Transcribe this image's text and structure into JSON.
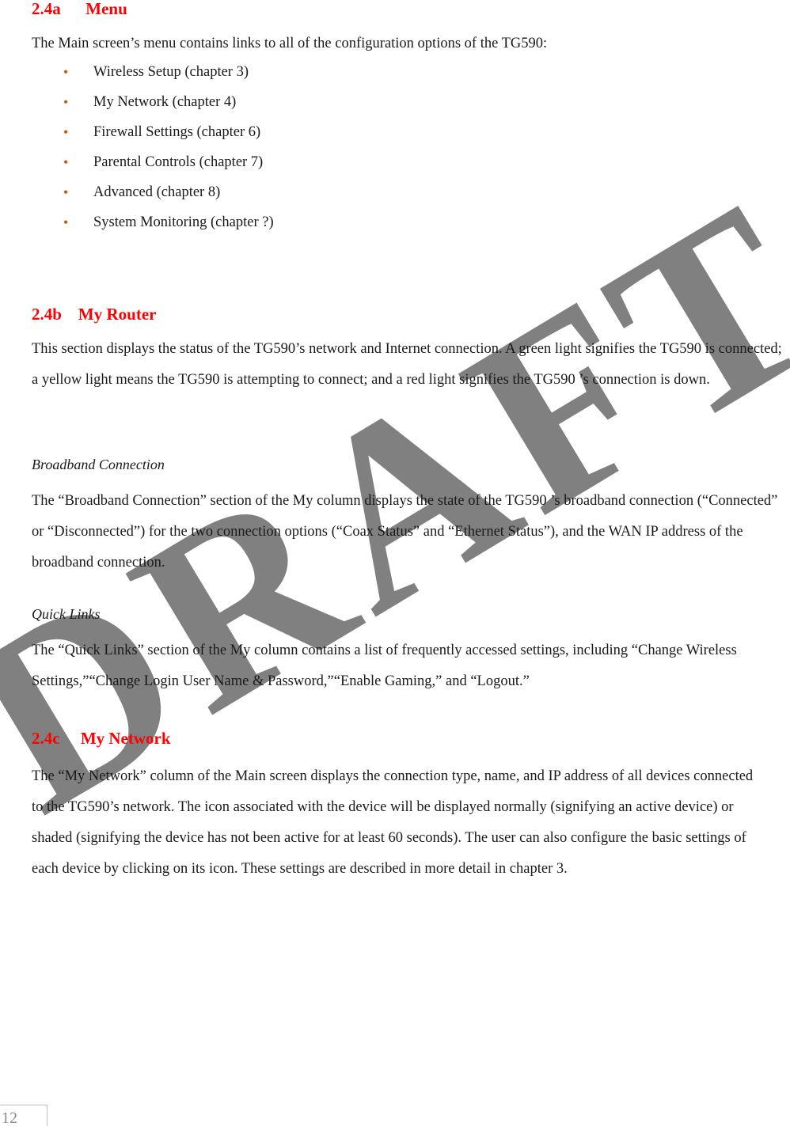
{
  "page": {
    "number": "12",
    "watermark": "DRAFT",
    "watermark_color": "#808080",
    "heading_color": "#FF0000",
    "bullet_color": "#C55A11",
    "body_color": "#1a1a1a"
  },
  "sections": [
    {
      "id": "menu",
      "number": "2.4a",
      "title": "Menu",
      "heading_text": "2.4a      Menu",
      "intro": "The Main screen’s menu contains links to all of the configuration options of the TG590:",
      "bullet_glyph": "•",
      "bullets": [
        "Wireless Setup (chapter 3)",
        "My Network (chapter 4)",
        "Firewall Settings (chapter 6)",
        "Parental Controls (chapter 7)",
        "Advanced (chapter 8)",
        "System Monitoring (chapter ?)"
      ]
    },
    {
      "id": "my-router",
      "number": "2.4b",
      "title": "My Router",
      "heading_text": "2.4b    My Router",
      "intro": "This section displays the status of the TG590’s network and Internet connection. A green light signifies the TG590  is connected; a yellow light means the TG590  is attempting to connect; and a red light signifies the TG590 ’s connection is down.",
      "subsections": [
        {
          "id": "broadband-connection",
          "title": "Broadband Connection",
          "body": "The “Broadband Connection” section of the My  column displays the state of the TG590 ’s broadband connection (“Connected” or “Disconnected”) for the two connection options (“Coax Status” and “Ethernet Status”), and the WAN IP address of the broadband connection."
        },
        {
          "id": "quick-links",
          "title": "Quick Links",
          "body": "The “Quick Links” section of the My column contains a list of frequently accessed settings, including “Change Wireless Settings,”“Change Login User Name & Password,”“Enable Gaming,” and “Logout.”"
        }
      ]
    },
    {
      "id": "my-network",
      "number": "2.4c",
      "title": "My Network",
      "heading_text": "2.4c     My Network",
      "intro": "The “My Network” column of the Main screen displays the connection type, name, and IP address of all devices connected to the TG590’s network. The icon associated with the device will be displayed normally (signifying an active device) or shaded (signifying the device has not been active for at least 60 seconds). The user can also configure the basic settings of each device by clicking on its icon. These settings are described in more detail in chapter 3."
    }
  ]
}
